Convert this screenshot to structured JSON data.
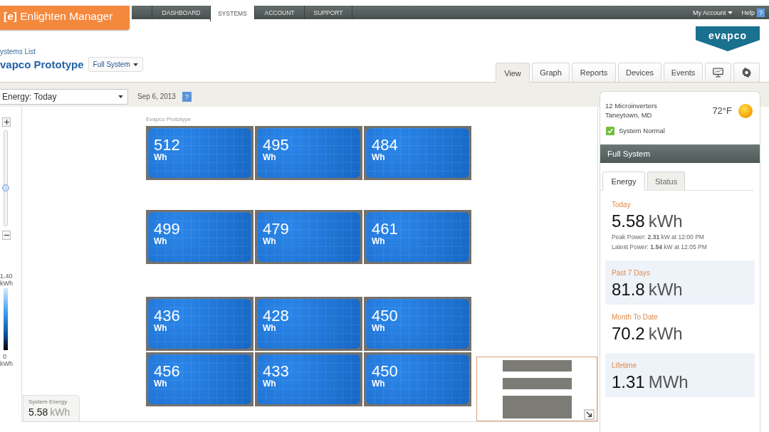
{
  "logo": {
    "mark": "[e]",
    "name": "Enlighten Manager"
  },
  "nav": {
    "tabs": [
      {
        "label": "DASHBOARD",
        "selected": false
      },
      {
        "label": "SYSTEMS",
        "selected": true
      },
      {
        "label": "ACCOUNT",
        "selected": false
      },
      {
        "label": "SUPPORT",
        "selected": false
      }
    ],
    "account": "My Account",
    "help": {
      "label": "Help",
      "icon": "?"
    }
  },
  "header": {
    "breadcrumb": "ystems List",
    "title": "vapco Prototype",
    "view_select": "Full System",
    "brand_logo": "evapco",
    "tabs": [
      {
        "label": "View",
        "selected": true
      },
      {
        "label": "Graph",
        "selected": false
      },
      {
        "label": "Reports",
        "selected": false
      },
      {
        "label": "Devices",
        "selected": false
      },
      {
        "label": "Events",
        "selected": false
      }
    ]
  },
  "toolbar": {
    "metric_select": "Energy: Today",
    "date": "Sep 6, 2013",
    "help_icon": "?"
  },
  "zoom_slider": {
    "level": 0.4
  },
  "legend": {
    "max": "1.40",
    "max_unit": "kWh",
    "min": "0",
    "min_unit": "kWh"
  },
  "array_view": {
    "label": "Evapco Prototype",
    "arrays": [
      {
        "rows": [
          [
            {
              "value": "512",
              "unit": "Wh"
            },
            {
              "value": "495",
              "unit": "Wh"
            },
            {
              "value": "484",
              "unit": "Wh"
            }
          ]
        ]
      },
      {
        "rows": [
          [
            {
              "value": "499",
              "unit": "Wh"
            },
            {
              "value": "479",
              "unit": "Wh"
            },
            {
              "value": "461",
              "unit": "Wh"
            }
          ]
        ]
      },
      {
        "rows": [
          [
            {
              "value": "436",
              "unit": "Wh"
            },
            {
              "value": "428",
              "unit": "Wh"
            },
            {
              "value": "450",
              "unit": "Wh"
            }
          ],
          [
            {
              "value": "456",
              "unit": "Wh"
            },
            {
              "value": "433",
              "unit": "Wh"
            },
            {
              "value": "450",
              "unit": "Wh"
            }
          ]
        ]
      }
    ]
  },
  "system_energy": {
    "label": "System Energy",
    "value": "5.58",
    "unit": "kWh"
  },
  "summary": {
    "inverters": "12 Microinverters",
    "location": "Taneytown, MD",
    "temperature": "72°F",
    "status": {
      "label": "System Normal",
      "ok": true
    },
    "section": "Full System",
    "tabs": [
      {
        "label": "Energy",
        "selected": true
      },
      {
        "label": "Status",
        "selected": false
      }
    ],
    "stats": [
      {
        "label": "Today",
        "value": "5.58",
        "unit": "kWh",
        "details": [
          "Peak Power: **2.31** kW at 12:00 PM",
          "Latest Power: **1.54** kW at 12:05 PM"
        ]
      },
      {
        "label": "Past 7 Days",
        "value": "81.8",
        "unit": "kWh"
      },
      {
        "label": "Month To Date",
        "value": "70.2",
        "unit": "kWh"
      },
      {
        "label": "Lifetime",
        "value": "1.31",
        "unit": "MWh"
      }
    ]
  }
}
